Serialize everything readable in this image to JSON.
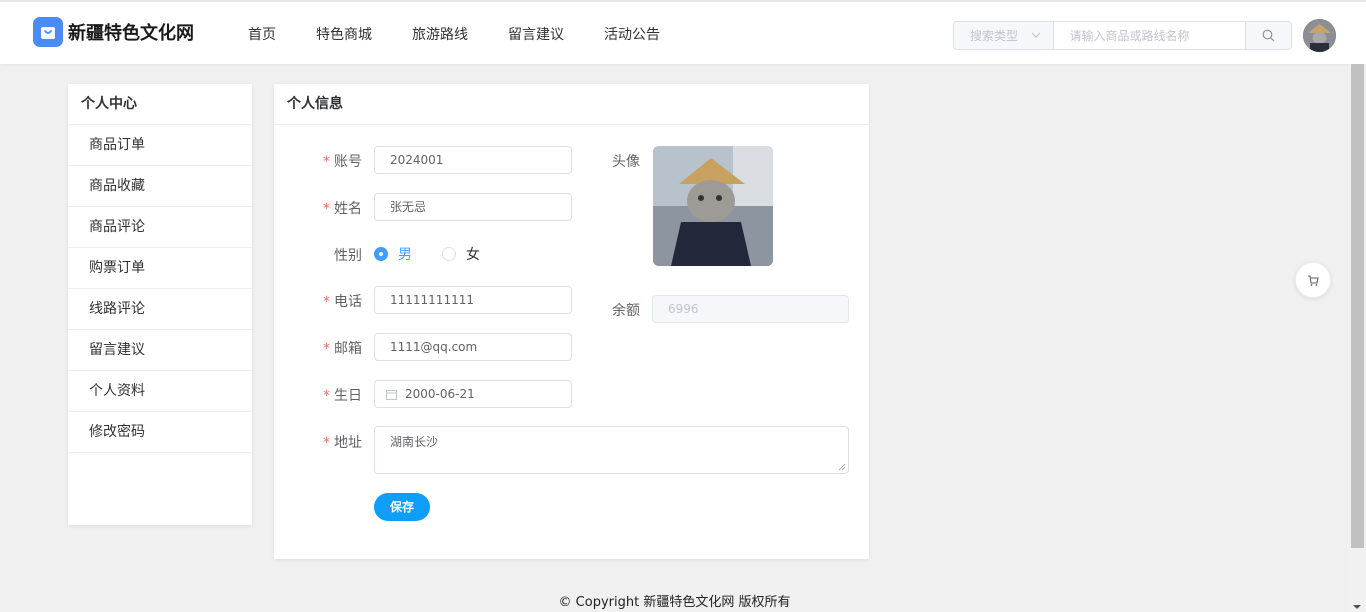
{
  "header": {
    "site_name": "新疆特色文化网",
    "nav": [
      "首页",
      "特色商城",
      "旅游路线",
      "留言建议",
      "活动公告"
    ],
    "search_type_placeholder": "搜索类型",
    "search_placeholder": "请输入商品或路线名称"
  },
  "sidebar": {
    "title": "个人中心",
    "items": [
      "商品订单",
      "商品收藏",
      "商品评论",
      "购票订单",
      "线路评论",
      "留言建议",
      "个人资料",
      "修改密码"
    ]
  },
  "profile": {
    "title": "个人信息",
    "account_label": "账号",
    "account": "2024001",
    "name_label": "姓名",
    "name": "张无忌",
    "gender_label": "性别",
    "gender_male": "男",
    "gender_female": "女",
    "phone_label": "电话",
    "phone": "11111111111",
    "email_label": "邮箱",
    "email": "1111@qq.com",
    "birthday_label": "生日",
    "birthday": "2000-06-21",
    "address_label": "地址",
    "address": "湖南长沙",
    "avatar_label": "头像",
    "balance_label": "余额",
    "balance": "6996",
    "save_label": "保存"
  },
  "footer": {
    "copyright": "© Copyright 新疆特色文化网 版权所有"
  },
  "colors": {
    "primary": "#0e9ef7",
    "required": "#f56c6c",
    "logo": "#4a8cf7"
  }
}
